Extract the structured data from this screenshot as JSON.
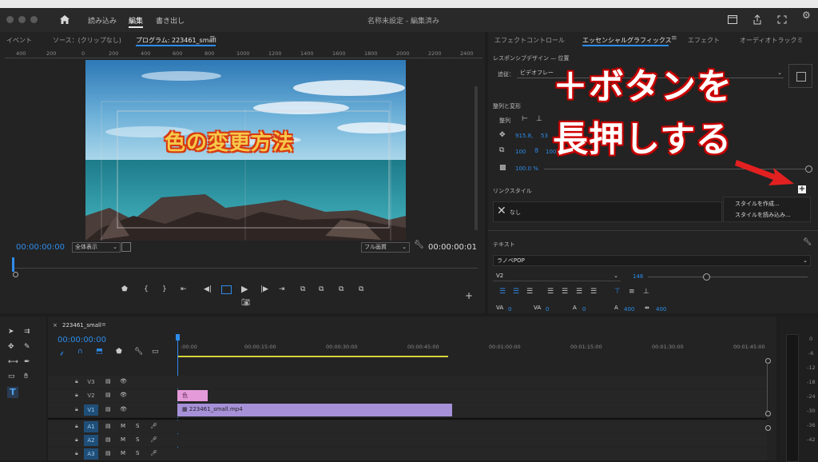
{
  "titlebar": {
    "menu": [
      "読み込み",
      "編集",
      "書き出し"
    ],
    "active_menu": "編集",
    "project_title": "名称未設定 - 編集済み"
  },
  "left_panel": {
    "tabs": [
      "イベント",
      "ソース：(クリップなし)",
      "プログラム: 223461_small"
    ],
    "ruler_marks": [
      "400",
      "200",
      "0",
      "200",
      "400",
      "600",
      "800",
      "1000",
      "1200",
      "1400",
      "1600",
      "1800",
      "2000",
      "2200",
      "2400"
    ],
    "video_title_text": "色の変更方法",
    "timecode_left": "00:00:00:00",
    "zoom_select": "全体表示",
    "quality_select": "フル画質",
    "timecode_right": "00:00:00:01"
  },
  "right_panel": {
    "tabs": [
      "エフェクトコントロール",
      "エッセンシャルグラフィックス",
      "エフェクト",
      "オーディオトラックミ"
    ],
    "active_tab": "エッセンシャルグラフィックス",
    "responsive_label": "レスポンシブデザイン — 位置",
    "pin_label": "追従：",
    "pin_value": "ビデオフレー",
    "align_section": "整列と変形",
    "align_label": "整列",
    "pos_x": "915.8,",
    "pos_y": "53",
    "scale": "100",
    "scale_pct": "100",
    "scale_unit": "%",
    "rotation": "0",
    "opacity": "100.0 %",
    "link_style": "リンクスタイル",
    "none_label": "なし",
    "dropdown_items": [
      "スタイルを作成...",
      "スタイルを読み込み..."
    ],
    "text_section": "テキスト",
    "font_name": "ラノベPOP",
    "font_style": "V2",
    "font_size": "146",
    "metrics": [
      "0",
      "0",
      "0",
      "400"
    ]
  },
  "annotation": {
    "line1": "＋ボタンを",
    "line2": "長押しする",
    "arrow_color": "#e32020"
  },
  "timeline": {
    "sequence_name": "223461_small",
    "timecode": "00:00:00:00",
    "ruler_labels": [
      ":00:00",
      "00:00:15:00",
      "00:00:30:00",
      "00:00:45:00",
      "00:01:00:00",
      "00:01:15:00",
      "00:01:30:00",
      "00:01:45:00"
    ],
    "tracks": [
      {
        "name": "V3",
        "selected": false
      },
      {
        "name": "V2",
        "selected": false
      },
      {
        "name": "V1",
        "selected": true
      },
      {
        "name": "A1",
        "selected": true
      },
      {
        "name": "A2",
        "selected": true
      },
      {
        "name": "A3",
        "selected": true
      }
    ],
    "graphic_clip_label": "色",
    "video_clip_label": "223461_small.mp4"
  },
  "meter": {
    "labels": [
      "0",
      "-6",
      "-12",
      "-18",
      "-24",
      "-30",
      "-36",
      "-42"
    ]
  },
  "colors": {
    "accent_blue": "#2d8ceb",
    "clip_purple": "#a691d9",
    "graphic_pink": "#e49ad8",
    "playhead_blue": "#2d8ceb"
  }
}
